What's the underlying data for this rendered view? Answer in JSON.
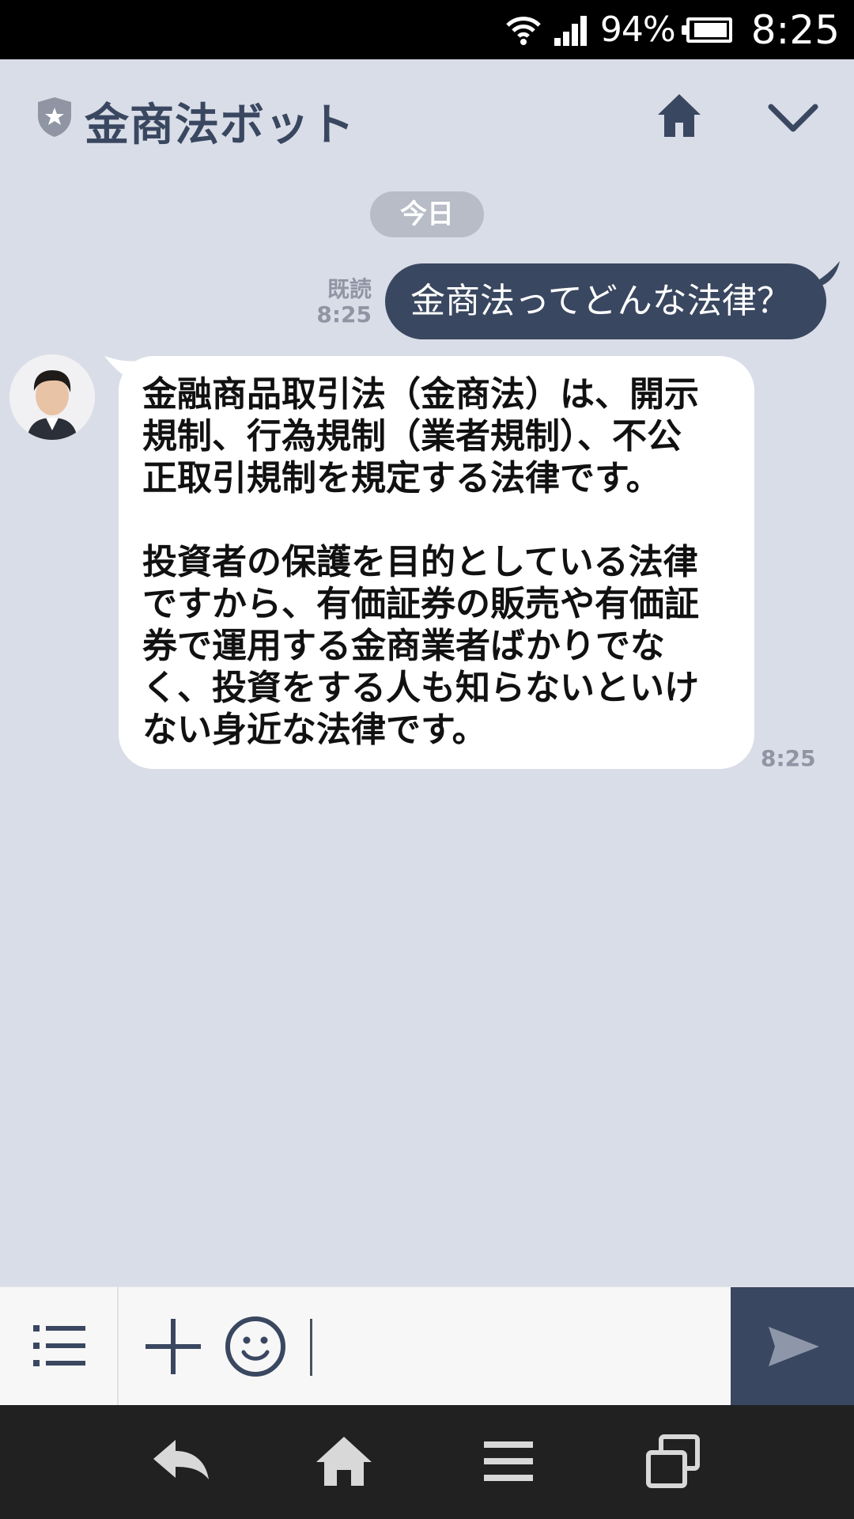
{
  "status_bar": {
    "battery_percent": "94%",
    "time": "8:25",
    "icons": [
      "wifi-icon",
      "signal-icon",
      "battery-icon"
    ]
  },
  "header": {
    "title": "金商法ボット",
    "icons": [
      "shield-star-icon",
      "home-icon",
      "chevron-down-icon"
    ]
  },
  "chat": {
    "date_label": "今日",
    "messages": [
      {
        "direction": "sent",
        "text": "金商法ってどんな法律？",
        "read_label": "既読",
        "time": "8:25"
      },
      {
        "direction": "received",
        "text": "金融商品取引法（金商法）は、開示\n規制、行為規制（業者規制）、不公\n正取引規制を規定する法律です。\n\n投資者の保護を目的としている法律\nですから、有価証券の販売や有価証\n券で運用する金商業者ばかりでな\nく、投資をする人も知らないといけ\nない身近な法律です。",
        "time": "8:25"
      }
    ]
  },
  "input_bar": {
    "icons": [
      "menu-list-icon",
      "plus-icon",
      "emoji-icon",
      "send-icon"
    ],
    "value": ""
  },
  "nav_bar": {
    "icons": [
      "back-icon",
      "home-icon",
      "menu-icon",
      "recent-apps-icon"
    ]
  },
  "colors": {
    "header_bg": "#d9dde7",
    "accent": "#3a4760",
    "status_bar_bg": "#000000",
    "nav_bar_bg": "#212121"
  }
}
